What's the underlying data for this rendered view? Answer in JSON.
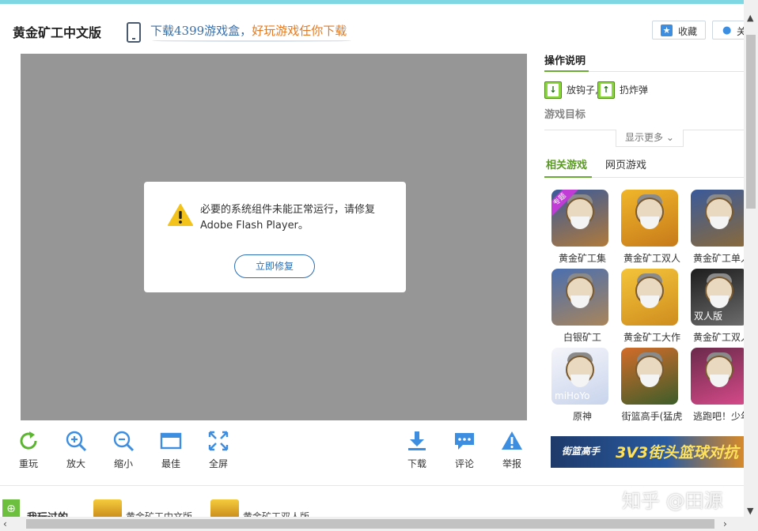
{
  "header": {
    "game_title": "黄金矿工中文版",
    "promo_a": "下载4399游戏盒，",
    "promo_b": "好玩游戏任你下载",
    "favorite_label": "收藏",
    "idea_label": "关"
  },
  "dialog": {
    "message": "必要的系统组件未能正常运行，请修复 Adobe Flash Player。",
    "repair_label": "立即修复"
  },
  "toolbar": {
    "replay": "重玩",
    "zoom_in": "放大",
    "zoom_out": "缩小",
    "best": "最佳",
    "fullscreen": "全屏",
    "download": "下载",
    "comment": "评论",
    "report": "举报"
  },
  "sidebar": {
    "ops_title": "操作说明",
    "key_down_text": "放钩子,",
    "key_up_text": "扔炸弹",
    "goal_title": "游戏目标",
    "more_label": "显示更多",
    "tab_related": "相关游戏",
    "tab_web": "网页游戏",
    "games": [
      {
        "name": "黄金矿工集",
        "tag": "专题",
        "caption": ""
      },
      {
        "name": "黄金矿工双人",
        "tag": "",
        "caption": ""
      },
      {
        "name": "黄金矿工单人",
        "tag": "",
        "caption": ""
      },
      {
        "name": "白银矿工",
        "tag": "",
        "caption": ""
      },
      {
        "name": "黄金矿工大作",
        "tag": "",
        "caption": ""
      },
      {
        "name": "黄金矿工双人",
        "tag": "",
        "caption": "双人版"
      },
      {
        "name": "原神",
        "tag": "",
        "caption": "miHoYo"
      },
      {
        "name": "街篮高手(猛虎",
        "tag": "",
        "caption": ""
      },
      {
        "name": "逃跑吧！少年",
        "tag": "",
        "caption": ""
      }
    ],
    "banner_logo": "街篮高手",
    "banner_text": "3V3街头篮球对抗"
  },
  "bottom": {
    "played_label": "我玩过的",
    "played_1": "黄金矿工中文版",
    "played_2": "黄金矿工双人版"
  },
  "watermark": "知乎 @田源",
  "colors": {
    "accent_green": "#6aac32",
    "accent_blue": "#3d8ee0",
    "game_bg": "#969696"
  }
}
